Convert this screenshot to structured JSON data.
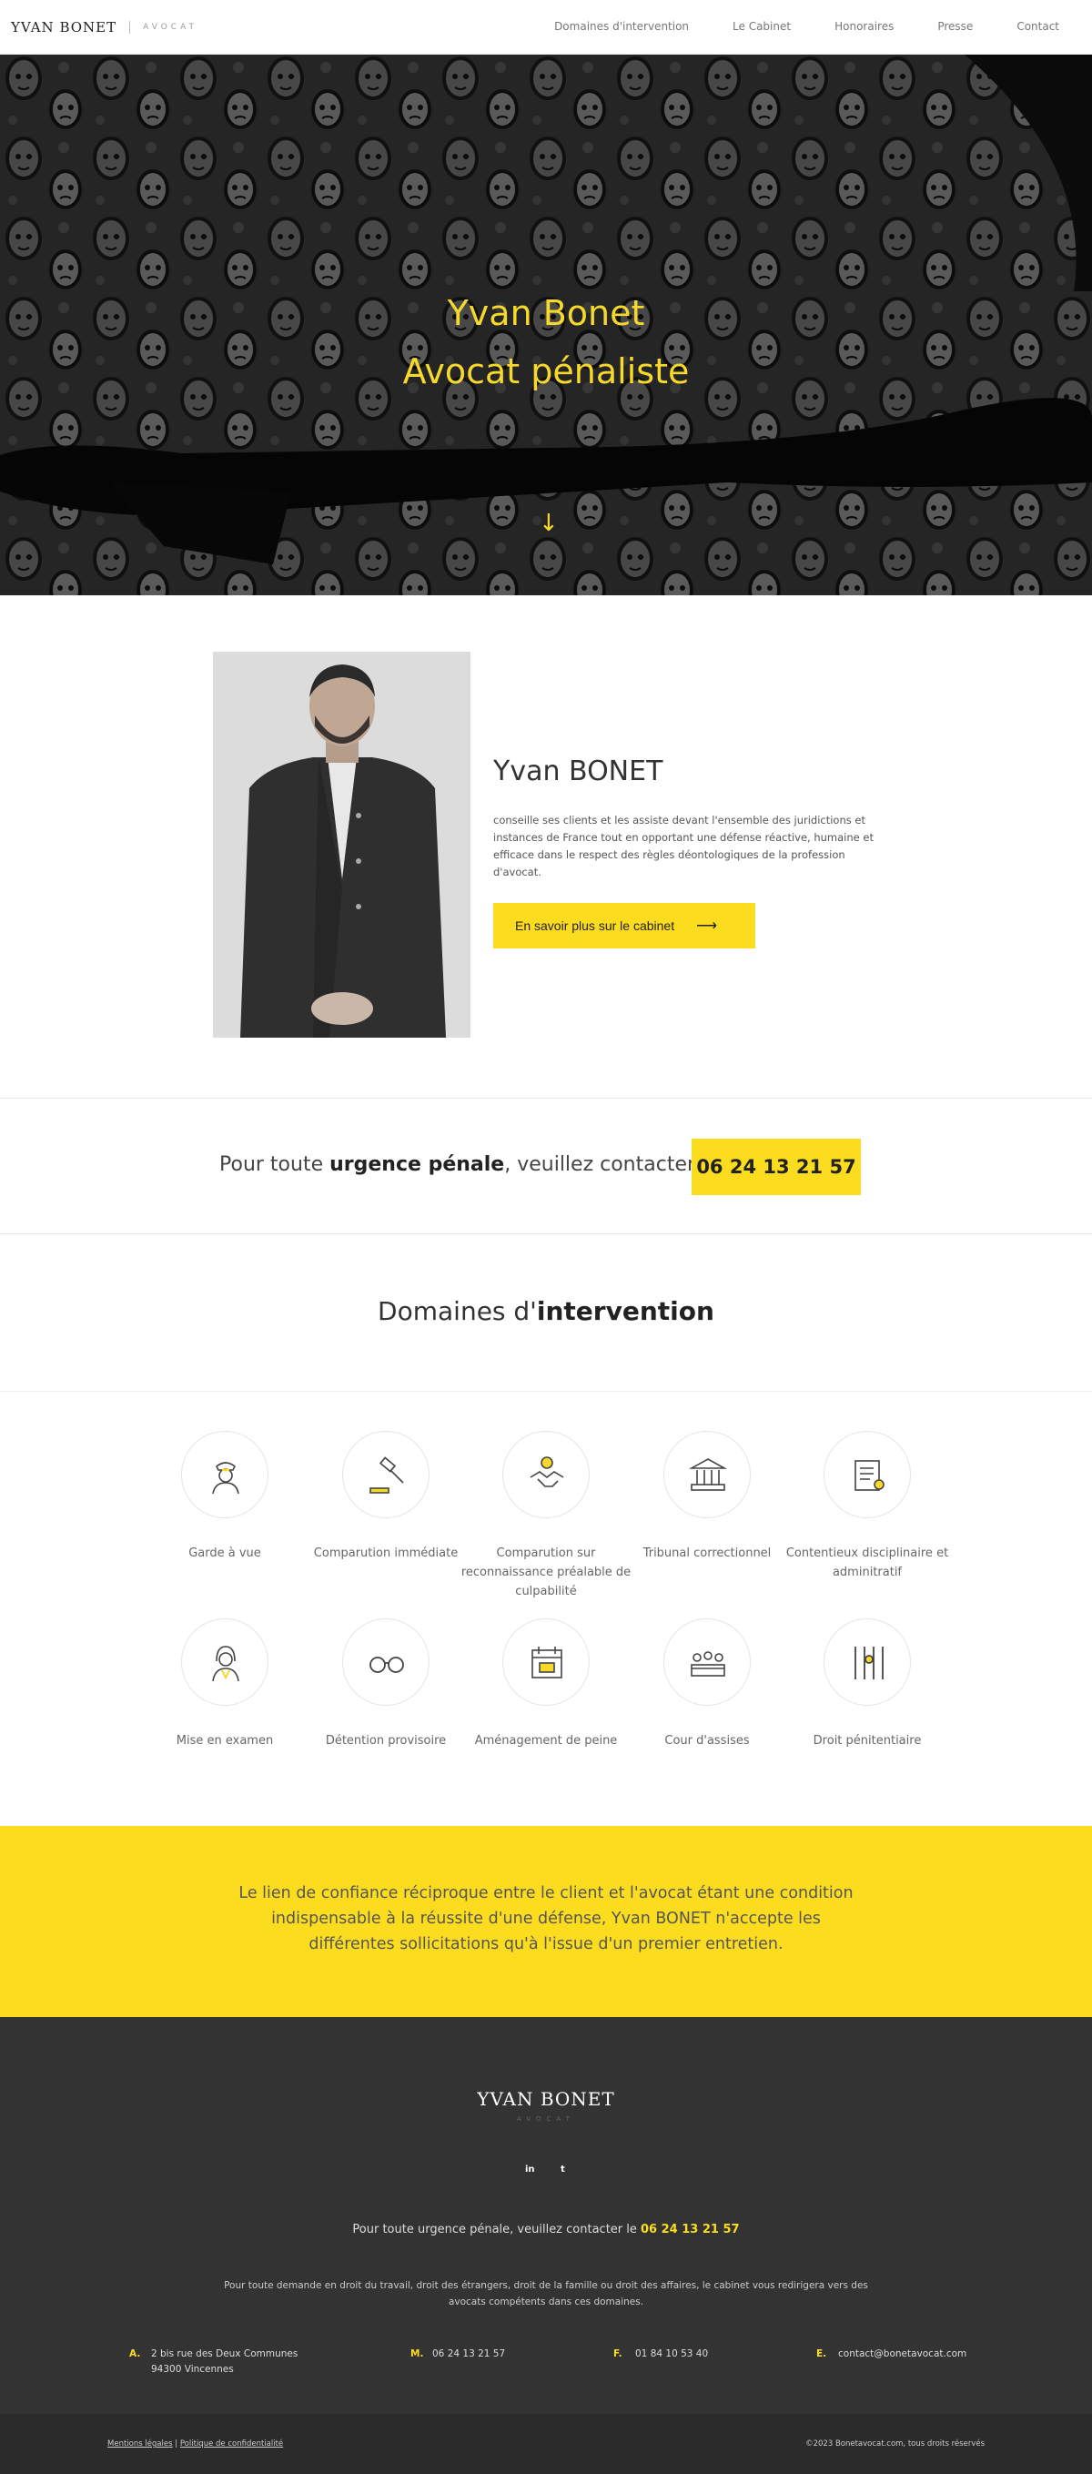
{
  "header": {
    "logo_name": "YVAN BONET",
    "logo_sub": "AVOCAT",
    "nav": [
      "Domaines d'intervention",
      "Le Cabinet",
      "Honoraires",
      "Presse",
      "Contact"
    ]
  },
  "hero": {
    "title_line1": "Yvan Bonet",
    "title_line2": "Avocat pénaliste",
    "arrow": "↓"
  },
  "about": {
    "name": "Yvan BONET",
    "text": "conseille ses clients et les assiste devant l'ensemble des juridictions et instances de France tout en opportant une défense réactive, humaine et efficace dans le respect des règles déontologiques de la profession d'avocat.",
    "button_label": "En savoir plus sur le cabinet",
    "button_arrow": "⟶"
  },
  "urgence": {
    "prefix": "Pour toute ",
    "bold": "urgence pénale",
    "suffix": ", veuillez contacter le",
    "phone": "06 24 13 21 57"
  },
  "domaines": {
    "title_prefix": "Domaines d'",
    "title_bold": "intervention",
    "items": [
      {
        "label": "Garde à vue",
        "icon": "police-officer-icon"
      },
      {
        "label": "Comparution immédiate",
        "icon": "gavel-icon"
      },
      {
        "label": "Comparution sur reconnaissance préalable de culpabilité",
        "icon": "handshake-icon"
      },
      {
        "label": "Tribunal correctionnel",
        "icon": "courthouse-icon"
      },
      {
        "label": "Contentieux disciplinaire et adminitratif",
        "icon": "document-scroll-icon"
      },
      {
        "label": "Mise en examen",
        "icon": "lawyer-icon"
      },
      {
        "label": "Détention provisoire",
        "icon": "handcuffs-icon"
      },
      {
        "label": "Aménagement de peine",
        "icon": "calendar-icon"
      },
      {
        "label": "Cour d'assises",
        "icon": "jury-icon"
      },
      {
        "label": "Droit pénitentiaire",
        "icon": "prison-bars-icon"
      }
    ]
  },
  "quote": {
    "text": "Le lien de confiance réciproque entre le client et l'avocat étant une condition indispensable à la réussite d'une défense, Yvan BONET n'accepte les différentes sollicitations qu'à l'issue d'un premier entretien."
  },
  "footer": {
    "logo_name": "YVAN BONET",
    "logo_sub": "AVOCAT",
    "social": [
      "in",
      "t"
    ],
    "urgence_text": "Pour toute urgence pénale, veuillez contacter le ",
    "urgence_phone": "06 24 13 21 57",
    "note": "Pour toute demande en droit du travail, droit des étrangers, droit de la famille ou droit des affaires, le cabinet vous redirigera vers des avocats compétents dans ces domaines.",
    "contacts": [
      {
        "key": "A.",
        "line1": "2 bis rue des Deux Communes",
        "line2": "94300 Vincennes"
      },
      {
        "key": "M.",
        "line1": "06 24 13 21 57",
        "line2": ""
      },
      {
        "key": "F.",
        "line1": "01 84 10 53 40",
        "line2": ""
      },
      {
        "key": "E.",
        "line1": "contact@bonetavocat.com",
        "line2": ""
      }
    ],
    "link_legal": "Mentions légales",
    "link_sep": " | ",
    "link_privacy": "Politique de confidentialité",
    "copyright": "©2023 Bonetavocat.com, tous droits réservés"
  },
  "colors": {
    "accent": "#fcdc1f",
    "hero_text": "#f6d92a",
    "footer_bg": "#333333"
  }
}
